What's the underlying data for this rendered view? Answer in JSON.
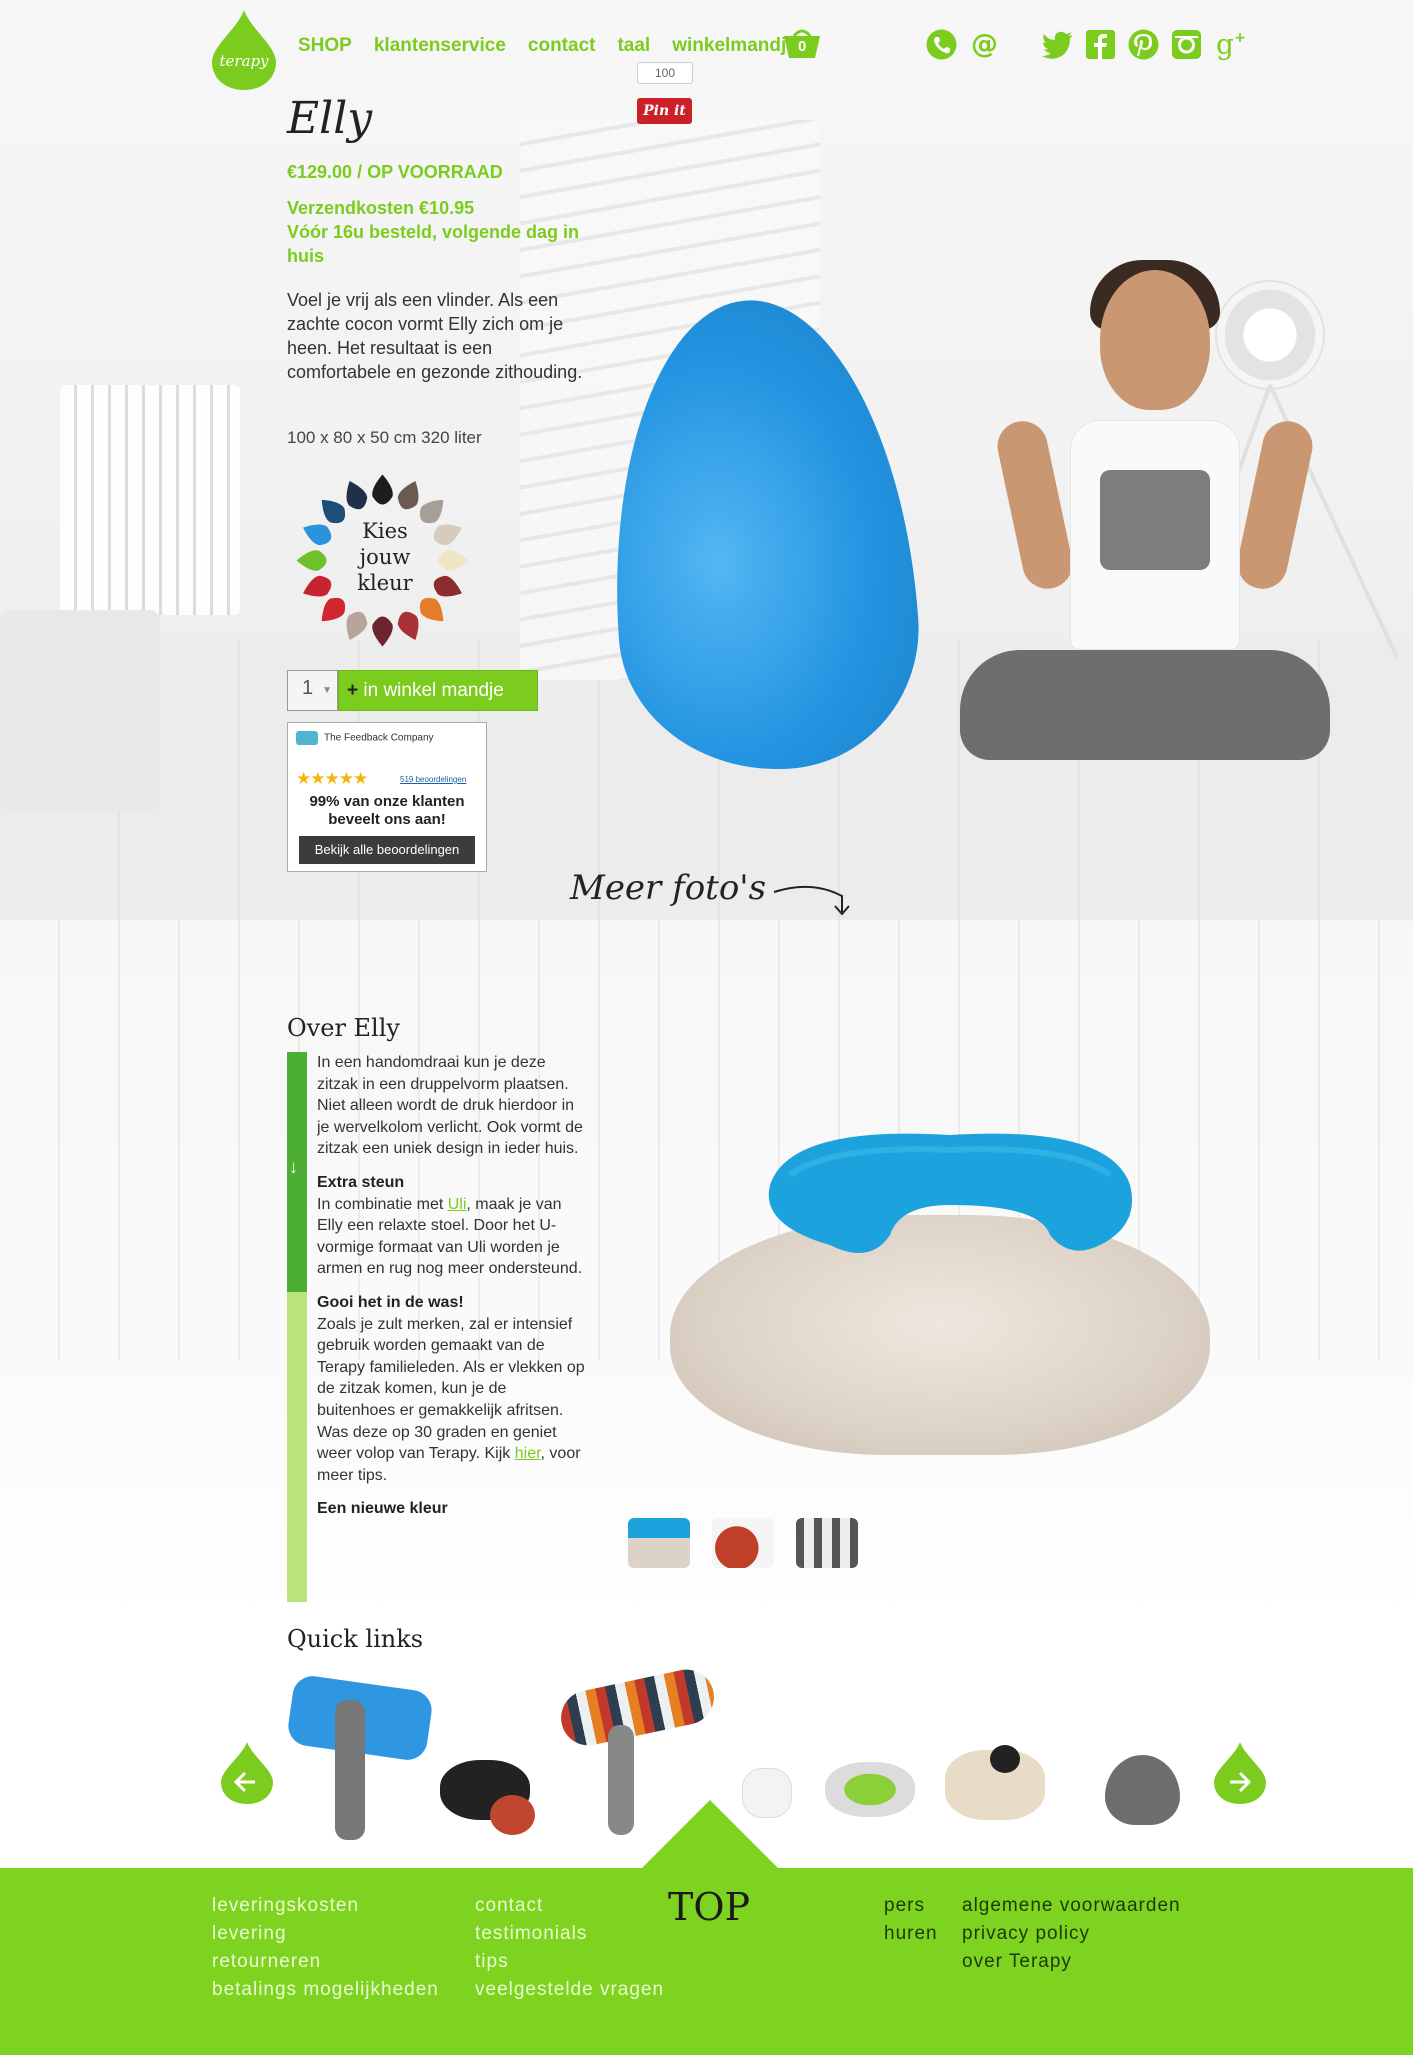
{
  "nav": {
    "items": [
      "SHOP",
      "klantenservice",
      "contact",
      "taal",
      "winkelmandje"
    ],
    "cart_count": "0",
    "logo_text": "terapy"
  },
  "pinterest": {
    "count": "100",
    "label": "Pin it"
  },
  "product": {
    "title": "Elly",
    "price": "€129.00 / OP VOORRAAD",
    "shipping_line1": "Verzendkosten €10.95",
    "shipping_line2": "Vóór 16u besteld, volgende dag in huis",
    "description": "Voel je vrij als een vlinder. Als een zachte cocon vormt Elly zich om je heen. Het resultaat is een comfortabele en gezonde zithouding.",
    "dimensions": "100 x 80 x 50 cm  320 liter",
    "color_picker_label": "Kies jouw kleur",
    "quantity": "1",
    "add_to_cart": "in winkel mandje",
    "add_to_cart_plus": "+"
  },
  "feedback": {
    "company": "The Feedback Company",
    "stars": "★★★★★",
    "reviews": "519 beoordelingen",
    "pct": "99% van onze klanten beveelt ons aan!",
    "button": "Bekijk alle beoordelingen"
  },
  "more_photos": "Meer foto's",
  "about": {
    "title": "Over Elly",
    "intro": "In een handomdraai kun je deze zitzak in een druppelvorm plaatsen. Niet alleen wordt de druk hierdoor in je wervelkolom verlicht. Ook vormt de zitzak een uniek design in ieder huis.",
    "h1": "Extra steun",
    "p1_a": "In combinatie met ",
    "p1_link": "Uli",
    "p1_b": ", maak je van Elly een relaxte stoel. Door het U-vormige formaat van Uli worden je armen en rug nog meer ondersteund.",
    "h2": "Gooi het in de was!",
    "p2_a": "Zoals je zult merken, zal er intensief gebruik worden gemaakt van de Terapy familieleden. Als er vlekken op de zitzak komen, kun je de buitenhoes er gemakkelijk afritsen. Was deze op 30 graden en geniet weer volop van Terapy. Kijk ",
    "p2_link": "hier",
    "p2_b": ", voor meer tips.",
    "h3": "Een nieuwe kleur"
  },
  "quick_links": {
    "title": "Quick links"
  },
  "footer": {
    "col1": [
      "leveringskosten",
      "levering",
      "retourneren",
      "betalings mogelijkheden"
    ],
    "col2": [
      "contact",
      "testimonials",
      "tips",
      "veelgestelde vragen"
    ],
    "top": "TOP",
    "col3": [
      "pers",
      "huren"
    ],
    "col4": [
      "algemene voorwaarden",
      "privacy policy",
      "over Terapy"
    ]
  },
  "colors": {
    "brand_green": "#7ccc1f",
    "footer_green": "#7ed321",
    "bag_blue": "#2394e1",
    "pin_red": "#cb2027"
  },
  "icons": [
    "logo-drop-icon",
    "cart-icon",
    "phone-icon",
    "email-icon",
    "twitter-icon",
    "facebook-icon",
    "pinterest-icon",
    "instagram-icon",
    "google-plus-icon",
    "arrow-left-icon",
    "arrow-right-icon"
  ]
}
